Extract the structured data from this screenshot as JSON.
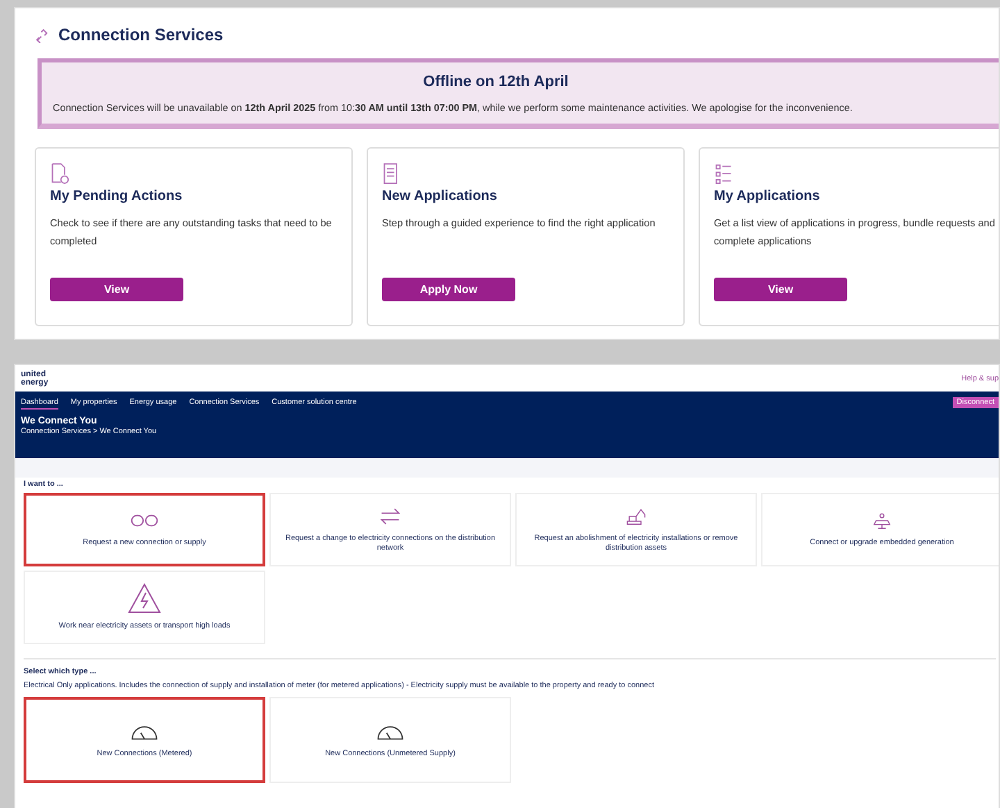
{
  "top": {
    "title": "Connection Services",
    "banner": {
      "title": "Offline on 12th April",
      "text": "Connection Services will be unavailable on **12th April 2025** from 10:**30 AM until 13th 07:00 PM**, while we perform some maintenance activities. We apologise for the inconvenience."
    },
    "cards": [
      {
        "kind": "pending",
        "title": "My Pending Actions",
        "text": "Check to see if there are any outstanding tasks that need to be completed",
        "button": "View"
      },
      {
        "kind": "new",
        "title": "New Applications",
        "text": "Step through a guided experience to find the right application",
        "button": "Apply Now"
      },
      {
        "kind": "list",
        "title": "My Applications",
        "text": "Get a list view of applications in progress, bundle requests and complete applications",
        "button": "View"
      }
    ]
  },
  "bottom": {
    "logo": "united energy",
    "help": "Help & sup",
    "nav": [
      {
        "label": "Dashboard",
        "selected": true
      },
      {
        "label": "My properties",
        "selected": false
      },
      {
        "label": "Energy usage",
        "selected": false
      },
      {
        "label": "Connection Services",
        "selected": false
      },
      {
        "label": "Customer solution centre",
        "selected": false
      }
    ],
    "nav_button": "Disconnect",
    "page_title": "We Connect You",
    "breadcrumb": "Connection Services > We Connect You",
    "want_heading": "I want to ...",
    "options": [
      {
        "kind": "plug",
        "label": "Request a new connection or supply",
        "selected": true
      },
      {
        "kind": "arrows",
        "label": "Request a change to electricity connections on the distribution network",
        "selected": false
      },
      {
        "kind": "excavator",
        "label": "Request an abolishment of electricity installations or remove distribution assets",
        "selected": false
      },
      {
        "kind": "solar",
        "label": "Connect or upgrade embedded generation",
        "selected": false
      },
      {
        "kind": "warning",
        "label": "Work near electricity assets or transport high loads",
        "selected": false
      }
    ],
    "type_heading": "Select which type ...",
    "type_text": "Electrical Only applications. Includes the connection of supply and installation of meter (for metered applications) - Electricity supply must be available to the property and ready to connect",
    "types": [
      {
        "label": "New Connections (Metered)",
        "selected": true
      },
      {
        "label": "New Connections (Unmetered Supply)",
        "selected": false
      }
    ]
  }
}
